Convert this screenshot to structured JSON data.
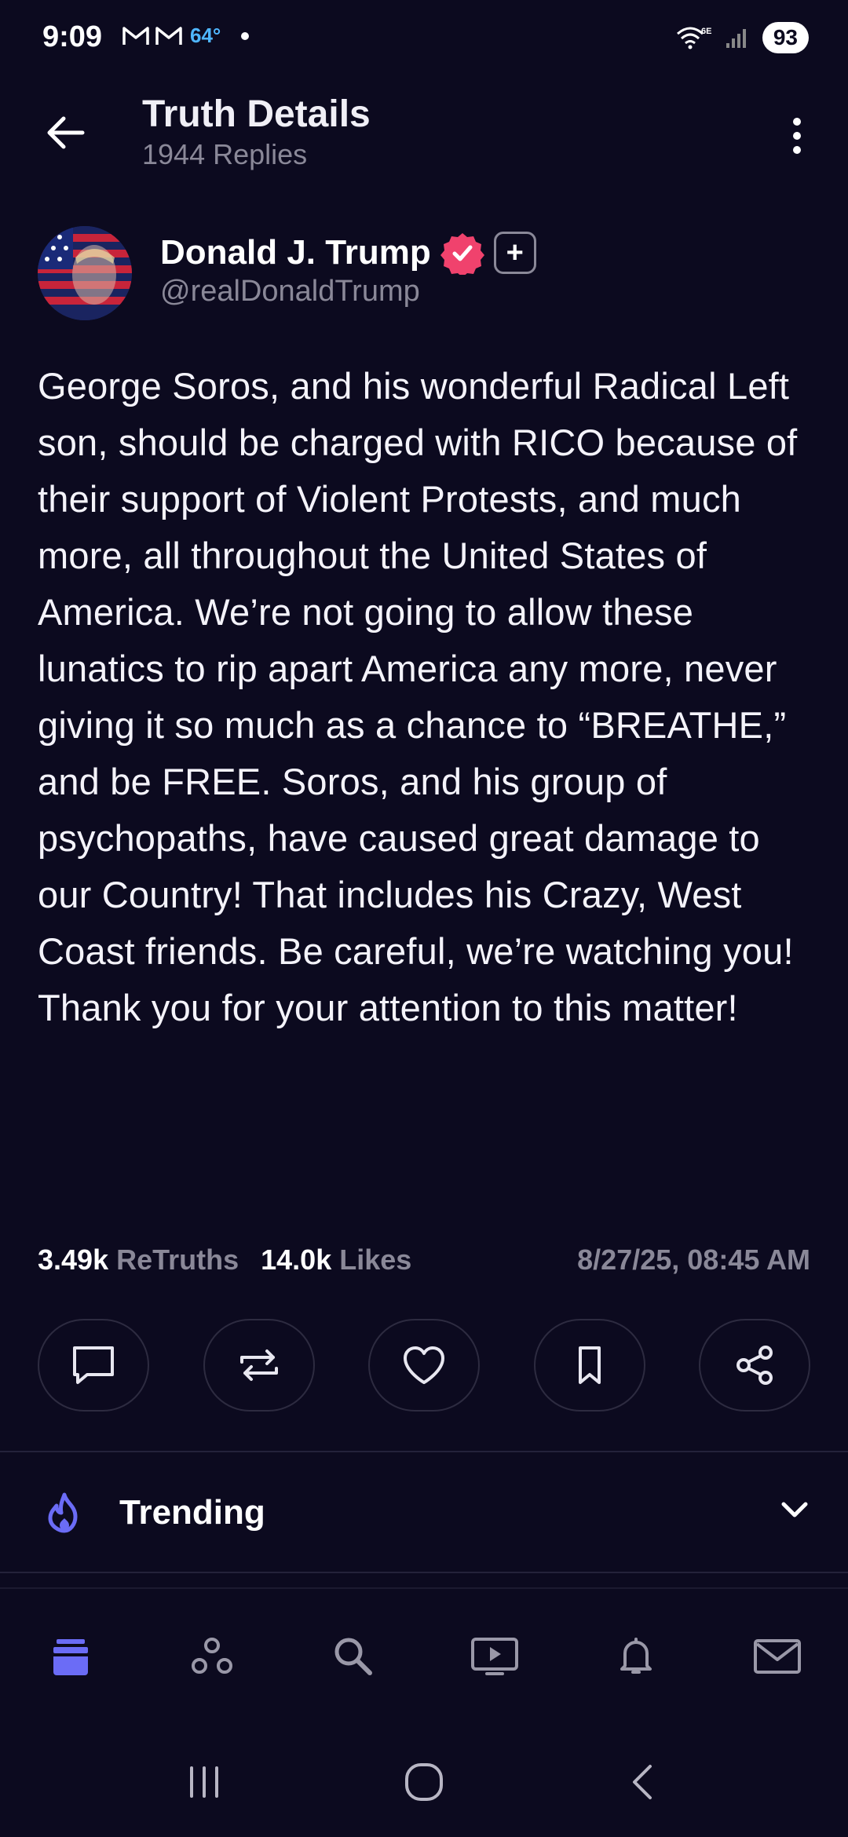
{
  "status_bar": {
    "time": "9:09",
    "temp": "64°",
    "battery": "93",
    "net": "6E"
  },
  "header": {
    "title": "Truth Details",
    "subtitle": "1944 Replies"
  },
  "author": {
    "name": "Donald J. Trump",
    "handle": "@realDonaldTrump",
    "plus": "+"
  },
  "post": {
    "body": "George Soros, and his wonderful Radical Left son, should be charged with RICO because of their support of Violent Protests, and much more, all throughout the United States of America. We’re not going to allow these lunatics to rip apart America any more, never giving it so much as a chance to “BREATHE,” and be FREE. Soros, and his group of psychopaths, have caused great damage to our Country! That includes his Crazy, West Coast friends. Be careful, we’re watching you! Thank you for your attention to this matter!"
  },
  "stats": {
    "retruths_count": "3.49k",
    "retruths_label": "ReTruths",
    "likes_count": "14.0k",
    "likes_label": "Likes",
    "date": "8/27/25, 08:45 AM"
  },
  "actions": [
    "reply-icon",
    "retruth-icon",
    "heart-icon",
    "bookmark-icon",
    "share-icon"
  ],
  "trending": {
    "label": "Trending"
  },
  "bottom_nav": [
    "home-icon",
    "groups-icon",
    "search-icon",
    "video-icon",
    "bell-icon",
    "mail-icon"
  ],
  "colors": {
    "background": "#0c0a1f",
    "accent": "#6b6cf6",
    "muted": "#8a8898",
    "verified": "#f0426d"
  }
}
